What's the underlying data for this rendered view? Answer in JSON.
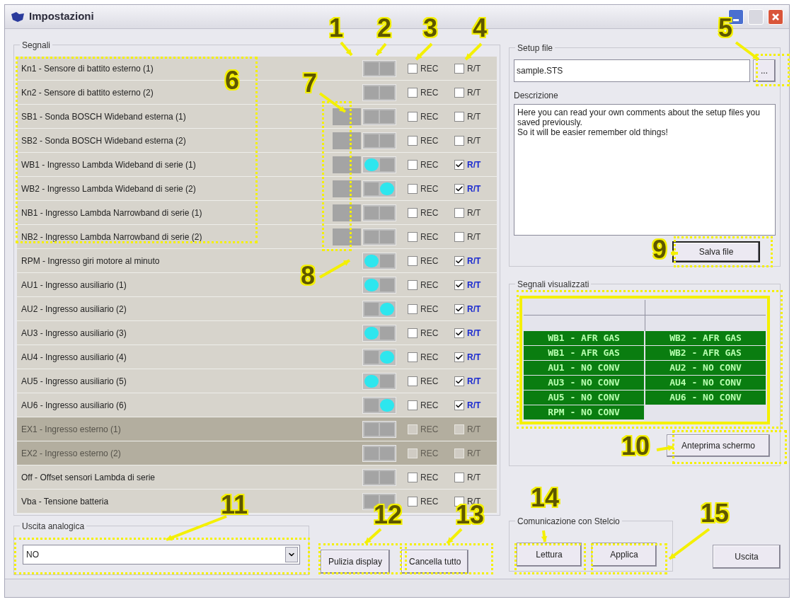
{
  "window": {
    "title": "Impostazioni"
  },
  "signals_group": {
    "title": "Segnali",
    "rows": [
      {
        "label": "Kn1 - Sensore di battito esterno (1)",
        "left_on": false,
        "right_on": false,
        "extra_block": false,
        "rec": false,
        "rt": false,
        "disabled": false,
        "rec_label": "REC",
        "rt_label": "R/T"
      },
      {
        "label": "Kn2 - Sensore di battito esterno (2)",
        "left_on": false,
        "right_on": false,
        "extra_block": false,
        "rec": false,
        "rt": false,
        "disabled": false,
        "rec_label": "REC",
        "rt_label": "R/T"
      },
      {
        "label": "SB1 - Sonda BOSCH Wideband esterna (1)",
        "left_on": false,
        "right_on": false,
        "extra_block": true,
        "rec": false,
        "rt": false,
        "disabled": false,
        "rec_label": "REC",
        "rt_label": "R/T"
      },
      {
        "label": "SB2 - Sonda BOSCH Wideband esterna (2)",
        "left_on": false,
        "right_on": false,
        "extra_block": true,
        "rec": false,
        "rt": false,
        "disabled": false,
        "rec_label": "REC",
        "rt_label": "R/T"
      },
      {
        "label": "WB1 - Ingresso Lambda Wideband di serie (1)",
        "left_on": true,
        "right_on": false,
        "extra_block": true,
        "rec": false,
        "rt": true,
        "disabled": false,
        "rec_label": "REC",
        "rt_label": "R/T"
      },
      {
        "label": "WB2 - Ingresso Lambda Wideband di serie (2)",
        "left_on": false,
        "right_on": true,
        "extra_block": true,
        "rec": false,
        "rt": true,
        "disabled": false,
        "rec_label": "REC",
        "rt_label": "R/T"
      },
      {
        "label": "NB1 - Ingresso Lambda Narrowband di serie (1)",
        "left_on": false,
        "right_on": false,
        "extra_block": true,
        "rec": false,
        "rt": false,
        "disabled": false,
        "rec_label": "REC",
        "rt_label": "R/T"
      },
      {
        "label": "NB2 - Ingresso Lambda Narrowband di serie (2)",
        "left_on": false,
        "right_on": false,
        "extra_block": true,
        "rec": false,
        "rt": false,
        "disabled": false,
        "rec_label": "REC",
        "rt_label": "R/T"
      },
      {
        "label": "RPM - Ingresso giri motore al minuto",
        "left_on": true,
        "right_on": false,
        "extra_block": false,
        "rec": false,
        "rt": true,
        "disabled": false,
        "rec_label": "REC",
        "rt_label": "R/T"
      },
      {
        "label": "AU1 - Ingresso ausiliario (1)",
        "left_on": true,
        "right_on": false,
        "extra_block": false,
        "rec": false,
        "rt": true,
        "disabled": false,
        "rec_label": "REC",
        "rt_label": "R/T"
      },
      {
        "label": "AU2 - Ingresso ausiliario (2)",
        "left_on": false,
        "right_on": true,
        "extra_block": false,
        "rec": false,
        "rt": true,
        "disabled": false,
        "rec_label": "REC",
        "rt_label": "R/T"
      },
      {
        "label": "AU3 - Ingresso ausiliario (3)",
        "left_on": true,
        "right_on": false,
        "extra_block": false,
        "rec": false,
        "rt": true,
        "disabled": false,
        "rec_label": "REC",
        "rt_label": "R/T"
      },
      {
        "label": "AU4 - Ingresso ausiliario (4)",
        "left_on": false,
        "right_on": true,
        "extra_block": false,
        "rec": false,
        "rt": true,
        "disabled": false,
        "rec_label": "REC",
        "rt_label": "R/T"
      },
      {
        "label": "AU5 - Ingresso ausiliario (5)",
        "left_on": true,
        "right_on": false,
        "extra_block": false,
        "rec": false,
        "rt": true,
        "disabled": false,
        "rec_label": "REC",
        "rt_label": "R/T"
      },
      {
        "label": "AU6 - Ingresso ausiliario (6)",
        "left_on": false,
        "right_on": true,
        "extra_block": false,
        "rec": false,
        "rt": true,
        "disabled": false,
        "rec_label": "REC",
        "rt_label": "R/T"
      },
      {
        "label": "EX1 - Ingresso esterno (1)",
        "left_on": false,
        "right_on": false,
        "extra_block": false,
        "rec": false,
        "rt": false,
        "disabled": true,
        "rec_label": "REC",
        "rt_label": "R/T"
      },
      {
        "label": "EX2 - Ingresso esterno (2)",
        "left_on": false,
        "right_on": false,
        "extra_block": false,
        "rec": false,
        "rt": false,
        "disabled": true,
        "rec_label": "REC",
        "rt_label": "R/T"
      },
      {
        "label": "Off - Offset sensori Lambda di serie",
        "left_on": false,
        "right_on": false,
        "extra_block": false,
        "rec": false,
        "rt": false,
        "disabled": false,
        "rec_label": "REC",
        "rt_label": "R/T"
      },
      {
        "label": "Vba - Tensione batteria",
        "left_on": false,
        "right_on": false,
        "extra_block": false,
        "rec": false,
        "rt": false,
        "disabled": false,
        "rec_label": "REC",
        "rt_label": "R/T"
      }
    ]
  },
  "setup_file": {
    "title": "Setup file",
    "file_name": "sample.STS",
    "browse_button": "...",
    "description_label": "Descrizione",
    "description": "Here you can read your own comments about the setup files you saved previously.\nSo it will be easier remember old things!",
    "save_button": "Salva file"
  },
  "displayed_signals": {
    "title": "Segnali visualizzati",
    "cells": [
      "WB1 - AFR GAS",
      "WB2 - AFR GAS",
      "WB1 - AFR GAS",
      "WB2 - AFR GAS",
      "AU1 - NO CONV",
      "AU2 - NO CONV",
      "AU3 - NO CONV",
      "AU4 - NO CONV",
      "AU5 - NO CONV",
      "AU6 - NO CONV",
      "RPM - NO CONV"
    ],
    "preview_button": "Anteprima schermo"
  },
  "analog_output": {
    "title": "Uscita analogica",
    "value": "NO"
  },
  "buttons_left": [
    "Pulizia display",
    "Cancella tutto"
  ],
  "communication": {
    "title": "Comunicazione con Stelcio",
    "buttons": [
      "Lettura",
      "Applica"
    ]
  },
  "exit_button": "Uscita",
  "callouts": [
    {
      "label": "1"
    },
    {
      "label": "2"
    },
    {
      "label": "3"
    },
    {
      "label": "4"
    },
    {
      "label": "5"
    },
    {
      "label": "6"
    },
    {
      "label": "7"
    },
    {
      "label": "8"
    },
    {
      "label": "9"
    },
    {
      "label": "10"
    },
    {
      "label": "11"
    },
    {
      "label": "12"
    },
    {
      "label": "13"
    },
    {
      "label": "14"
    },
    {
      "label": "15"
    }
  ]
}
